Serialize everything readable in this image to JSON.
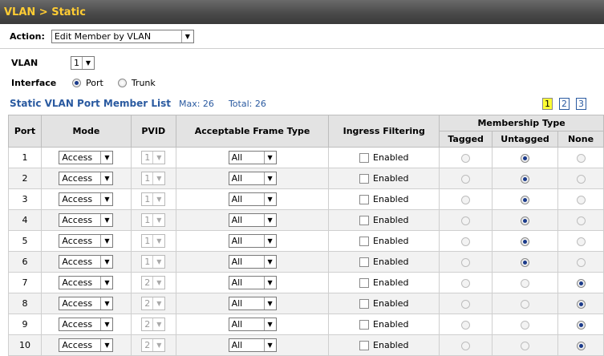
{
  "header": {
    "title": "VLAN > Static"
  },
  "action": {
    "label": "Action:",
    "value": "Edit Member by VLAN"
  },
  "vlan": {
    "label": "VLAN",
    "value": "1"
  },
  "interface": {
    "label": "Interface",
    "port_label": "Port",
    "trunk_label": "Trunk",
    "selected": "Port"
  },
  "list": {
    "title": "Static VLAN Port Member List",
    "max": "Max: 26",
    "total": "Total: 26",
    "pages": [
      "1",
      "2",
      "3"
    ],
    "current_page": "1"
  },
  "table": {
    "headers": {
      "port": "Port",
      "mode": "Mode",
      "pvid": "PVID",
      "frame": "Acceptable Frame Type",
      "ingress": "Ingress Filtering",
      "membership": "Membership Type",
      "tagged": "Tagged",
      "untagged": "Untagged",
      "none": "None"
    },
    "enabled_label": "Enabled",
    "rows": [
      {
        "port": "1",
        "mode": "Access",
        "pvid": "1",
        "frame": "All",
        "membership": "untagged"
      },
      {
        "port": "2",
        "mode": "Access",
        "pvid": "1",
        "frame": "All",
        "membership": "untagged"
      },
      {
        "port": "3",
        "mode": "Access",
        "pvid": "1",
        "frame": "All",
        "membership": "untagged"
      },
      {
        "port": "4",
        "mode": "Access",
        "pvid": "1",
        "frame": "All",
        "membership": "untagged"
      },
      {
        "port": "5",
        "mode": "Access",
        "pvid": "1",
        "frame": "All",
        "membership": "untagged"
      },
      {
        "port": "6",
        "mode": "Access",
        "pvid": "1",
        "frame": "All",
        "membership": "untagged"
      },
      {
        "port": "7",
        "mode": "Access",
        "pvid": "2",
        "frame": "All",
        "membership": "none"
      },
      {
        "port": "8",
        "mode": "Access",
        "pvid": "2",
        "frame": "All",
        "membership": "none"
      },
      {
        "port": "9",
        "mode": "Access",
        "pvid": "2",
        "frame": "All",
        "membership": "none"
      },
      {
        "port": "10",
        "mode": "Access",
        "pvid": "2",
        "frame": "All",
        "membership": "none"
      }
    ]
  }
}
